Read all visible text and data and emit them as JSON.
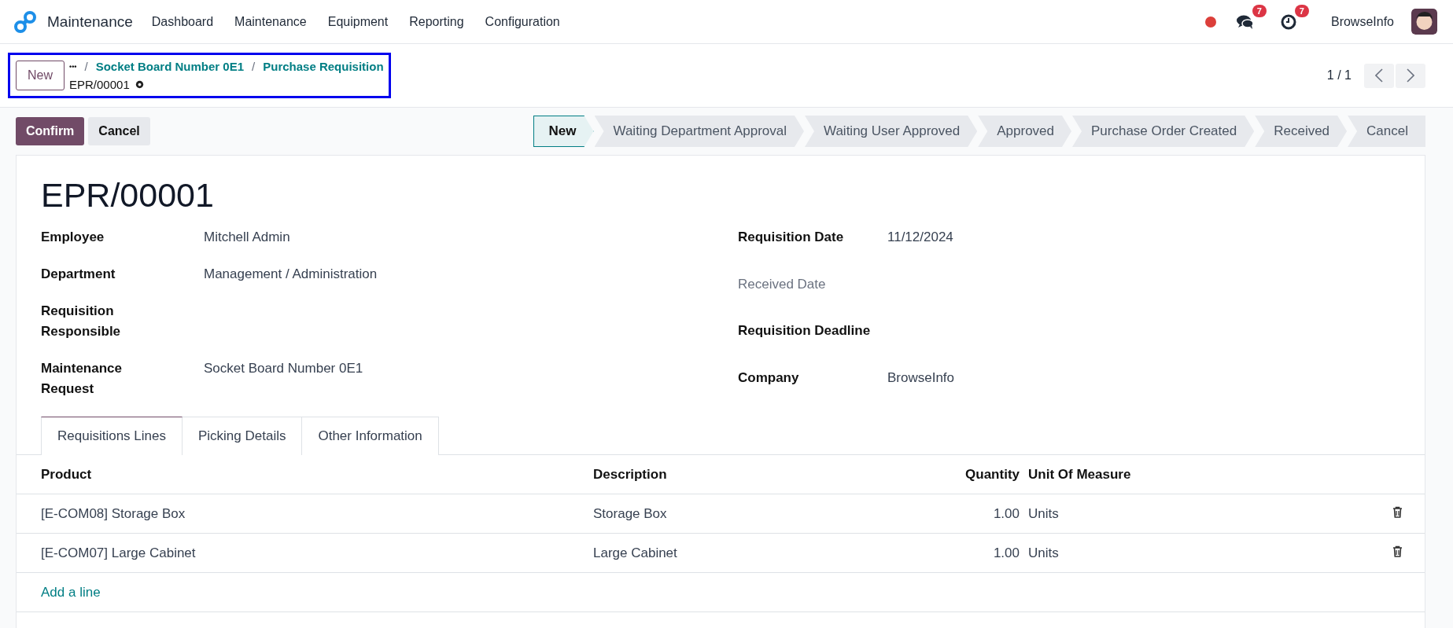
{
  "navbar": {
    "app_name": "Maintenance",
    "menu": [
      "Dashboard",
      "Maintenance",
      "Equipment",
      "Reporting",
      "Configuration"
    ],
    "messages_count": "7",
    "activities_count": "7",
    "company": "BrowseInfo"
  },
  "control_panel": {
    "new_button": "New",
    "breadcrumbs": [
      "Socket Board Number 0E1",
      "Purchase Requisition"
    ],
    "breadcrumb_more": "•••",
    "breadcrumb_separator": "/",
    "record_name": "EPR/00001",
    "pager": "1 / 1"
  },
  "actions": [
    {
      "label": "Confirm",
      "kind": "primary"
    },
    {
      "label": "Cancel",
      "kind": "secondary"
    }
  ],
  "status_bar": [
    {
      "label": "New",
      "selected": true
    },
    {
      "label": "Waiting Department Approval",
      "selected": false
    },
    {
      "label": "Waiting User Approved",
      "selected": false
    },
    {
      "label": "Approved",
      "selected": false
    },
    {
      "label": "Purchase Order Created",
      "selected": false
    },
    {
      "label": "Received",
      "selected": false
    },
    {
      "label": "Cancel",
      "selected": false
    }
  ],
  "form": {
    "title": "EPR/00001",
    "left_fields": [
      {
        "label": "Employee",
        "value": "Mitchell Admin",
        "muted": false
      },
      {
        "label": "Department",
        "value": "Management / Administration",
        "muted": false
      },
      {
        "label": "Requisition Responsible",
        "muted": false
      },
      {
        "label": "Maintenance Request",
        "value": "Socket Board Number 0E1",
        "muted": false
      }
    ],
    "right_fields": [
      {
        "label": "Requisition Date",
        "value": "11/12/2024",
        "muted": false
      },
      {
        "label": "Received Date",
        "muted": true
      },
      {
        "label": "Requisition Deadline",
        "muted": false
      },
      {
        "label": "Company",
        "value": "BrowseInfo",
        "muted": false
      }
    ],
    "tabs": [
      {
        "label": "Requisitions Lines",
        "selected": true
      },
      {
        "label": "Picking Details",
        "selected": false
      },
      {
        "label": "Other Information",
        "selected": false
      }
    ],
    "table": {
      "columns": [
        "Product",
        "Description",
        "Quantity",
        "Unit Of Measure"
      ],
      "rows": [
        {
          "product": "[E-COM08] Storage Box",
          "description": "Storage Box",
          "quantity": "1.00",
          "uom": "Units"
        },
        {
          "product": "[E-COM07] Large Cabinet",
          "description": "Large Cabinet",
          "quantity": "1.00",
          "uom": "Units"
        }
      ],
      "add_line": "Add a line"
    }
  }
}
